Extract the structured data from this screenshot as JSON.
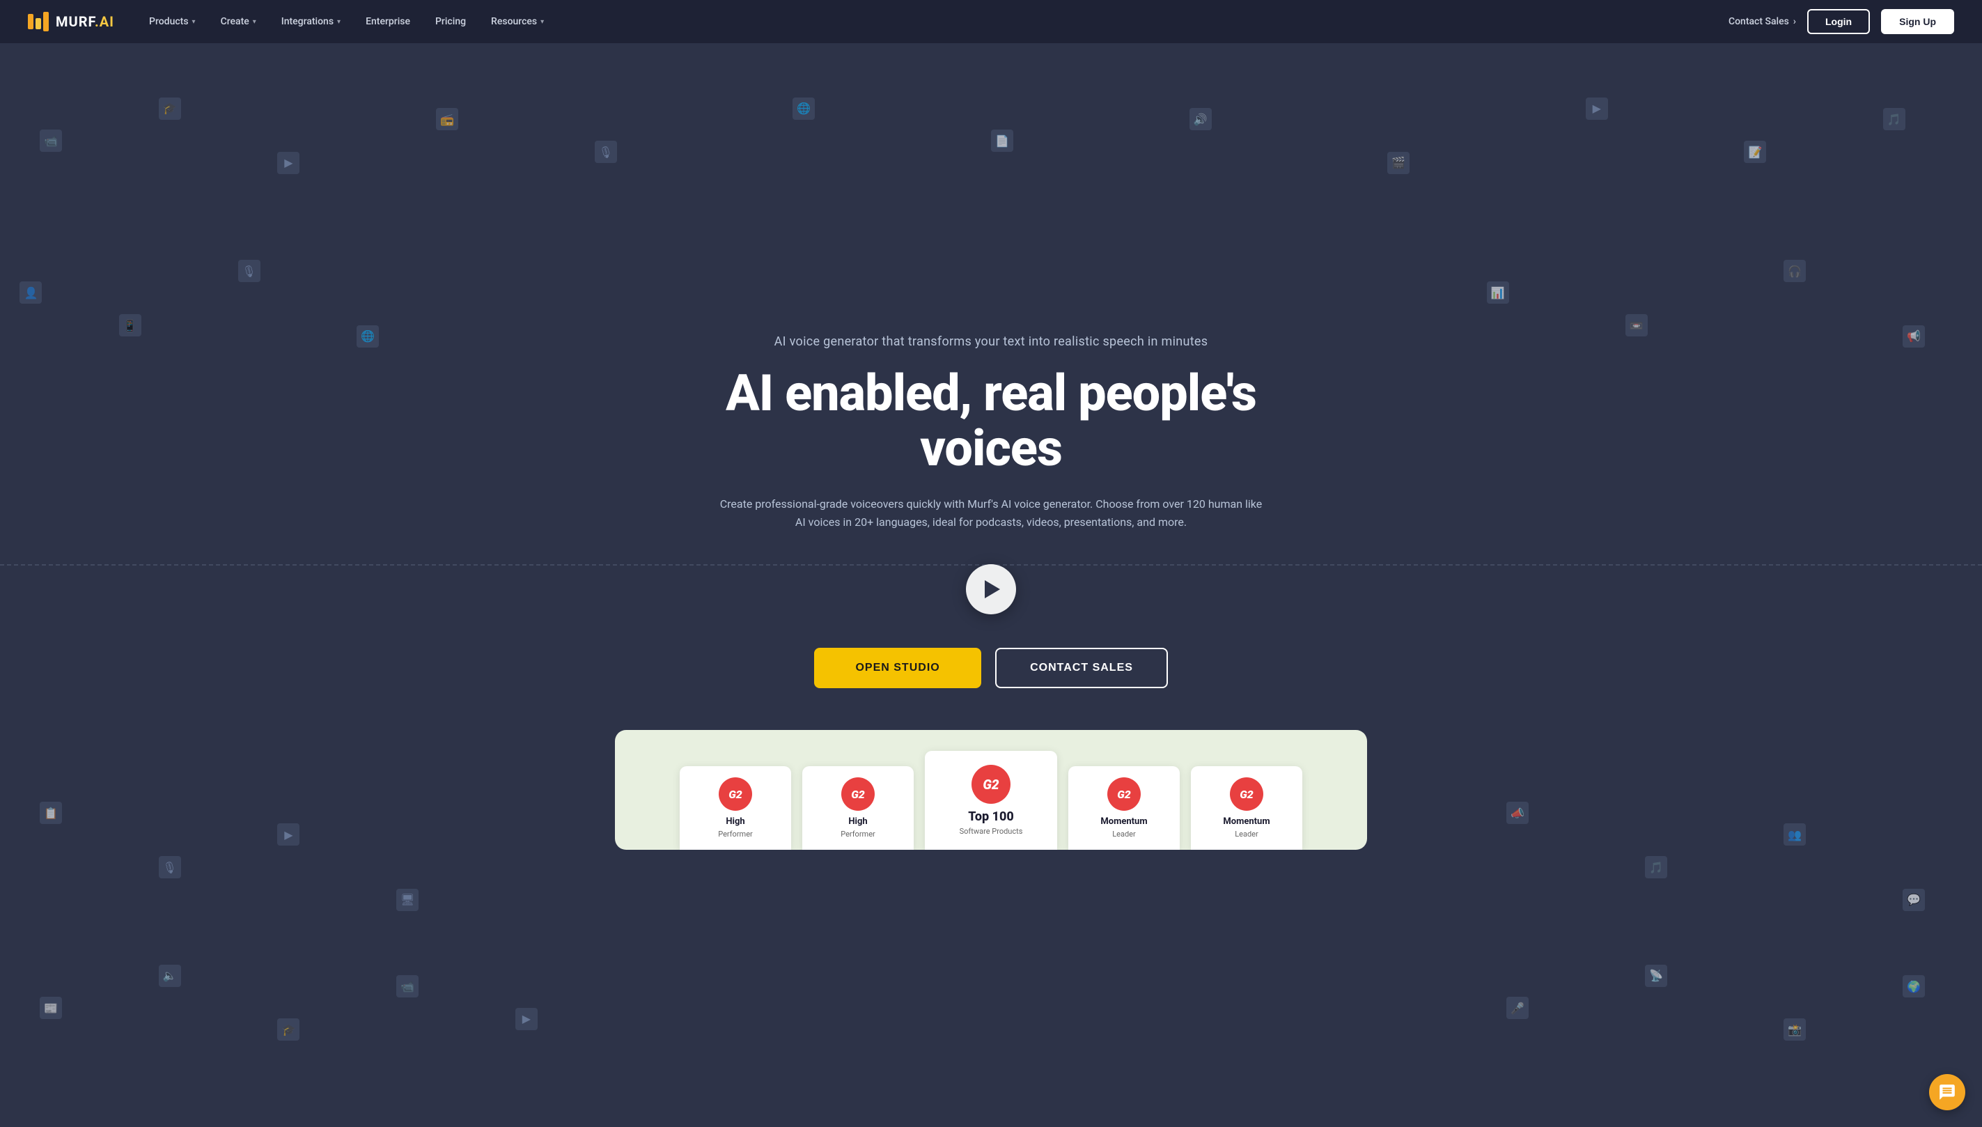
{
  "brand": {
    "name": "MURF",
    "suffix": ".AI"
  },
  "navbar": {
    "items": [
      {
        "id": "products",
        "label": "Products",
        "hasDropdown": true
      },
      {
        "id": "create",
        "label": "Create",
        "hasDropdown": true
      },
      {
        "id": "integrations",
        "label": "Integrations",
        "hasDropdown": true
      },
      {
        "id": "enterprise",
        "label": "Enterprise",
        "hasDropdown": false
      },
      {
        "id": "pricing",
        "label": "Pricing",
        "hasDropdown": false
      },
      {
        "id": "resources",
        "label": "Resources",
        "hasDropdown": true
      }
    ],
    "contact_sales": "Contact Sales",
    "login_label": "Login",
    "signup_label": "Sign Up"
  },
  "hero": {
    "subtitle": "AI voice generator that transforms your text into realistic speech in minutes",
    "title": "AI enabled, real people's voices",
    "description": "Create professional-grade voiceovers quickly with Murf's AI voice generator. Choose from over 120 human like AI voices in 20+ languages, ideal for podcasts, videos, presentations, and more.",
    "open_studio_label": "OPEN STUDIO",
    "contact_sales_label": "CONTACT SALES"
  },
  "awards": [
    {
      "id": "award-1",
      "badge": "G2",
      "title": "High",
      "subtitle": "Performer",
      "featured": false
    },
    {
      "id": "award-2",
      "badge": "G2",
      "title": "High",
      "subtitle": "Performer",
      "featured": false
    },
    {
      "id": "award-3",
      "badge": "G2",
      "title": "Top 100",
      "subtitle": "Software Products",
      "featured": true
    },
    {
      "id": "award-4",
      "badge": "G2",
      "title": "Momentum",
      "subtitle": "Leader",
      "featured": false
    },
    {
      "id": "award-5",
      "badge": "G2",
      "title": "Momentum",
      "subtitle": "Leader",
      "featured": false
    }
  ],
  "colors": {
    "navbar_bg": "#1e2235",
    "hero_bg": "#2d3348",
    "accent_yellow": "#f5c200",
    "white": "#ffffff",
    "text_muted": "#b8c4d8"
  },
  "icons": {
    "chat": "💬",
    "play": "▶"
  }
}
